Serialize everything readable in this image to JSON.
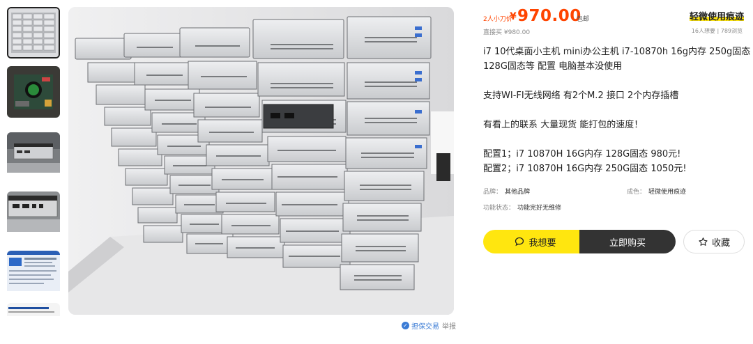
{
  "thumbnails": [
    {
      "name": "thumb-stacked-mini-pcs",
      "active": true
    },
    {
      "name": "thumb-motherboard",
      "active": false
    },
    {
      "name": "thumb-mini-pc-front",
      "active": false
    },
    {
      "name": "thumb-mini-pc-ports",
      "active": false
    },
    {
      "name": "thumb-screen-specs",
      "active": false
    },
    {
      "name": "thumb-screen-bios",
      "active": false
    }
  ],
  "footer_links": {
    "guarantee": "担保交易",
    "report": "举报"
  },
  "price": {
    "cut_label": "2人小刀价",
    "currency": "¥",
    "amount": "970.00",
    "shipping": "包邮",
    "direct_buy": "直接买 ¥980.00"
  },
  "condition_badge": "轻微使用痕迹",
  "stats": "16人想要 | 789浏览",
  "description": [
    "i7 10代桌面小主机 mini办公主机 i7-10870h 16g内存 250g固态 128G固态等 配置 电脑基本没使用",
    "",
    "支持WI-FI无线网络 有2个M.2 接口 2个内存插槽",
    "",
    "有看上的联系 大量现货 能打包的速度！",
    "",
    "配置1；i7 10870H 16G内存 128G固态 980元!",
    "配置2；i7 10870H 16G内存 250G固态 1050元!"
  ],
  "attributes": {
    "brand_label": "品牌：",
    "brand_value": "其他品牌",
    "condition_label": "成色：",
    "condition_value": "轻微使用痕迹",
    "function_label": "功能状态：",
    "function_value": "功能完好无维修"
  },
  "actions": {
    "want": "我想要",
    "buy": "立即购买",
    "favorite": "收藏"
  },
  "colors": {
    "accent_yellow": "#ffe60f",
    "price_red": "#ff4400",
    "buy_dark": "#333333"
  }
}
